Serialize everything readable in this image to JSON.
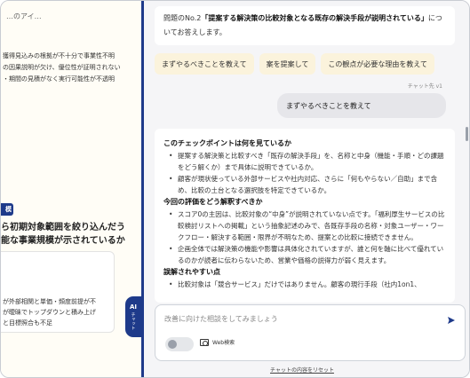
{
  "document": {
    "top_text": "…のアイ…",
    "paragraph": [
      "獲得見込みの根拠が不十分で事業性不明",
      "の因果説明が欠け、優位性が証明されない",
      "・期間の見積がなく実行可能性が不透明"
    ],
    "tag": "模",
    "heading": [
      "ら初期対象範囲を絞り込んだう",
      "能な事業規模が示されているか"
    ],
    "card_lines": [
      "が外部相関と単価・頻度前提が不",
      "が曖昧でトップダウンと積み上げ",
      "と目標照合も不足"
    ]
  },
  "chat_handle": {
    "ai": "AI",
    "label": "チャット"
  },
  "chat": {
    "question": {
      "prefix": "問題のNo.2",
      "bold": "「提案する解決策の比較対象となる既存の解決手段が説明されている」",
      "suffix": "についてお答えします。"
    },
    "suggestions": [
      "まずやるべきことを教えて",
      "案を提案して",
      "この観点が必要な理由を教えて"
    ],
    "version_label": "チャット先 v1",
    "user_message": "まずやるべきことを教えて",
    "answer": {
      "sections": [
        {
          "heading": "このチェックポイントは何を見ているか",
          "bullets": [
            "提案する解決策と比較すべき「既存の解決手段」を、名称と中身（機能・手順・どの課題をどう解くか）まで具体に説明できているか。",
            "顧客が現状使っている外部サービスや社内対応、さらに「何もやらない／自助」まで含め、比較の土台となる選択肢を特定できているか。"
          ]
        },
        {
          "heading": "今回の評価をどう解釈すべきか",
          "bullets": [
            "スコア0の主因は、比較対象の“中身”が説明されていない点です。「福利厚生サービスの比較検討リストへの掲載」という抽象記述のみで、各既存手段の名称・対象ユーザー・ワークフロー・解決する範囲・限界が不明なため、提案との比較に接続できません。",
            "企画全体では解決策の機能や影響は具体化されていますが、誰と何を軸に比べて優れているのかが読者に伝わらないため、営業や価格の説得力が弱く見えます。"
          ]
        },
        {
          "heading": "誤解されやすい点",
          "bullets": [
            "比較対象は「競合サービス」だけではありません。顧客の現行手段（社内1on1、"
          ]
        }
      ]
    },
    "input_placeholder": "改善に向けた相談をしてみましょう",
    "web_search_label": "Web検索",
    "web_search_enabled": false,
    "reset_label": "チャットの内容をリセット"
  },
  "colors": {
    "accent": "#1e3a8a",
    "suggestion_bg": "#fbf3dc",
    "user_bubble_bg": "#e6e6ea"
  }
}
